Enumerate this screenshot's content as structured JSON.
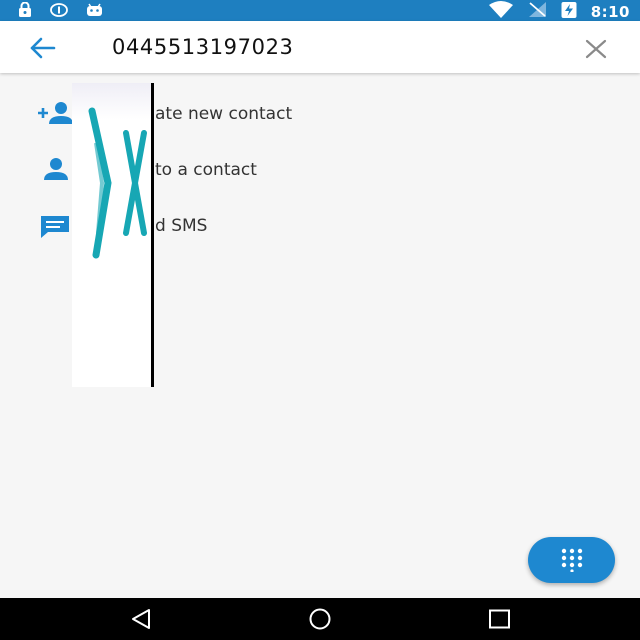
{
  "status_bar": {
    "time": "8:10",
    "left_icons": [
      "lock-icon",
      "info-icon",
      "android-icon"
    ],
    "right_icons": [
      "wifi-icon",
      "no-signal-icon",
      "battery-charging-icon"
    ]
  },
  "search": {
    "value": "0445513197023",
    "back_icon": "arrow-back-icon",
    "clear_icon": "close-icon"
  },
  "actions": [
    {
      "icon": "person-add-icon",
      "label": "ate new contact"
    },
    {
      "icon": "person-icon",
      "label": "to a contact"
    },
    {
      "icon": "message-icon",
      "label": "d SMS"
    }
  ],
  "fab": {
    "icon": "dialpad-icon"
  },
  "navigation": [
    "back-triangle-icon",
    "home-circle-icon",
    "recents-square-icon"
  ],
  "colors": {
    "accent": "#1e88d0",
    "status_bar": "#1e7fc0",
    "background": "#f6f6f6",
    "overlay_mark": "#17a7b4"
  }
}
